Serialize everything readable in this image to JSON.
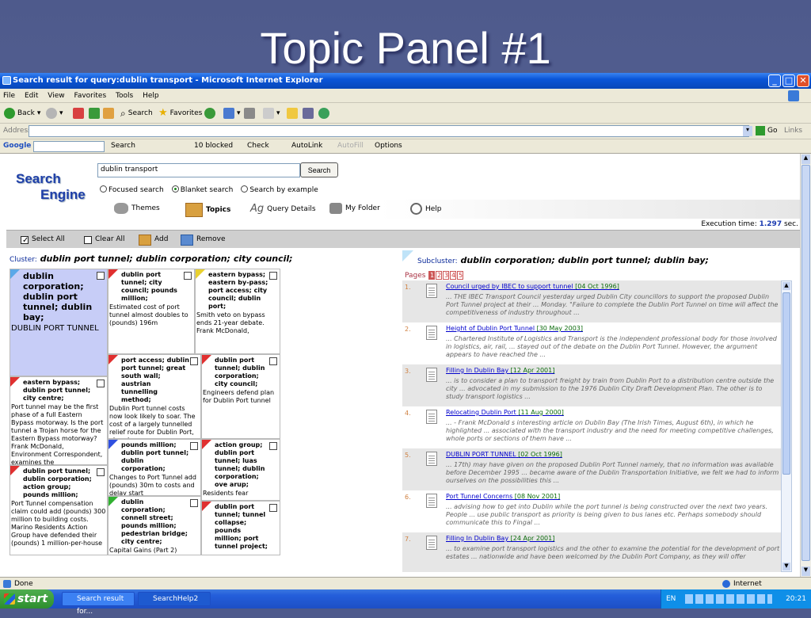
{
  "slide": {
    "title": "Topic Panel #1"
  },
  "window": {
    "title": "Search result for query:dublin transport - Microsoft Internet Explorer"
  },
  "menu": [
    "File",
    "Edit",
    "View",
    "Favorites",
    "Tools",
    "Help"
  ],
  "toolbar": {
    "back": "Back",
    "search": "Search",
    "favorites": "Favorites"
  },
  "address": {
    "label": "Address",
    "go": "Go",
    "links": "Links"
  },
  "googlebar": {
    "brand": "Google",
    "search": "Search",
    "blocked": "10 blocked",
    "check": "Check",
    "autolink": "AutoLink",
    "autofill": "AutoFill",
    "options": "Options"
  },
  "app": {
    "logo_line1": "Search",
    "logo_line2": "Engine",
    "query": "dublin transport",
    "search_button": "Search",
    "radios": [
      "Focused search",
      "Blanket search",
      "Search by example"
    ],
    "tabs": [
      "Themes",
      "Topics",
      "Query Details",
      "My Folder",
      "Help"
    ],
    "exec_label": "Execution time:",
    "exec_value": "1.297",
    "exec_unit": "sec.",
    "actions": [
      "Select All",
      "Clear All",
      "Add",
      "Remove"
    ],
    "cluster_label": "Cluster:",
    "cluster_value": "dublin port tunnel; dublin corporation; city council;",
    "subcluster_label": "Subcluster:",
    "subcluster_value": "dublin corporation; dublin port tunnel; dublin bay;",
    "pages_label": "Pages",
    "pages": [
      "1",
      "2",
      "3",
      "4",
      "5"
    ]
  },
  "topics": [
    {
      "title": "dublin corporation; dublin port tunnel; dublin bay;",
      "body": "DUBLIN PORT TUNNEL",
      "flag": "#5aa8e8"
    },
    {
      "title": "dublin port tunnel; city council; pounds million;",
      "body": "Estimated cost of port tunnel almost doubles to (pounds) 196m",
      "flag": "#e03030"
    },
    {
      "title": "eastern bypass; eastern by-pass; port access; city council; dublin port;",
      "body": "Smith veto on bypass ends 21-year debate. Frank McDonald,",
      "flag": "#e8d030"
    },
    {
      "title": "eastern bypass; dublin port tunnel; city centre;",
      "body": "Port tunnel may be the first phase of a full Eastern Bypass motorway. Is the port tunnel a Trojan horse for the Eastern Bypass motorway? Frank McDonald, Environment Correspondent, examines the",
      "flag": "#e03030"
    },
    {
      "title": "port access; dublin port tunnel; great south wall; austrian tunnelling method;",
      "body": "Dublin Port tunnel costs now look likely to soar. The cost of a largely tunnelled relief route for Dublin Port, already",
      "flag": "#e03030"
    },
    {
      "title": "dublin port tunnel; dublin corporation; city council;",
      "body": "Engineers defend plan for Dublin Port tunnel",
      "flag": "#e03030"
    },
    {
      "title": "dublin port tunnel; dublin corporation; action group; pounds million;",
      "body": "Port Tunnel compensation claim could add (pounds) 300 million to building costs. Marino Residents Action Group have defended their (pounds) 1 million-per-house",
      "flag": "#e03030"
    },
    {
      "title": "pounds million; dublin port tunnel; dublin corporation;",
      "body": "Changes to Port Tunnel add (pounds) 30m to costs and delay start",
      "flag": "#3050e0"
    },
    {
      "title": "action group; dublin port tunnel; luas tunnel; dublin corporation; ove arup;",
      "body": "Residents fear",
      "flag": "#e03030"
    },
    {
      "title": "dublin corporation; connell street; pounds million; pedestrian bridge; city centre;",
      "body": "Capital Gains (Part 2)",
      "flag": "#30b030"
    },
    {
      "title": "dublin port tunnel; tunnel collapse; pounds million; port tunnel project;",
      "body": "",
      "flag": "#e03030"
    }
  ],
  "results": [
    {
      "num": "1.",
      "title": "Council urged by IBEC to support tunnel",
      "date": "[04 Oct 1996]",
      "snippet": "... THE IBEC Transport Council yesterday urged Dublin City councillors to support the proposed Dublin Port Tunnel project at their ... Monday. \"Failure to complete the Dublin Port Tunnel on time will affect the competitiveness of industry throughout ..."
    },
    {
      "num": "2.",
      "title": "Height of Dublin Port Tunnel",
      "date": "[30 May 2003]",
      "snippet": "... Chartered Institute of Logistics and Transport is the independent professional body for those involved in logistics, air, rail, ... stayed out of the debate on the Dublin Port Tunnel. However, the argument appears to have reached the ..."
    },
    {
      "num": "3.",
      "title": "Filling In Dublin Bay",
      "date": "[12 Apr 2001]",
      "snippet": "... is to consider a plan to transport freight by train from Dublin Port to a distribution centre outside the city ... advocated in my submission to the 1976 Dublin City Draft Development Plan. The other is to study transport logistics ..."
    },
    {
      "num": "4.",
      "title": "Relocating Dublin Port",
      "date": "[11 Aug 2000]",
      "snippet": "... - Frank McDonald s interesting article on Dublin Bay (The Irish Times, August 6th), in which he highlighted ... associated with the transport industry and the need for meeting competitive challenges, whole ports or sections of them have ..."
    },
    {
      "num": "5.",
      "title": "DUBLIN PORT TUNNEL",
      "date": "[02 Oct 1996]",
      "snippet": "... 17th) may have given on the proposed Dublin Port Tunnel namely, that no information was available before December 1995 ... became aware of the Dublin Transportation Initiative, we felt we had to inform ourselves on the possibilities this ..."
    },
    {
      "num": "6.",
      "title": "Port Tunnel Concerns",
      "date": "[08 Nov 2001]",
      "snippet": "... advising how to get into Dublin while the port tunnel is being constructed over the next two years. People ... use public transport as priority is being given to bus lanes etc. Perhaps somebody should communicate this to Fingal ..."
    },
    {
      "num": "7.",
      "title": "Filling In Dublin Bay",
      "date": "[24 Apr 2001]",
      "snippet": "... to examine port transport logistics and the other to examine the potential for the development of port estates ... nationwide and have been welcomed by the Dublin Port Company, as they will offer"
    }
  ],
  "status": {
    "left": "Done",
    "zone": "Internet"
  },
  "taskbar": {
    "start": "start",
    "tasks": [
      "Search result for...",
      "SearchHelp2"
    ],
    "lang": "EN",
    "clock": "20:21"
  }
}
